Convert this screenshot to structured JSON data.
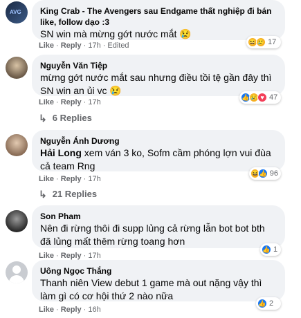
{
  "comments": [
    {
      "author": "King Crab - The Avengers sau Endgame thất nghiệp đi bán like, follow dạo :3",
      "text": "SN win mà mừng gớt nước mắt 😢",
      "like": "Like",
      "reply": "Reply",
      "time": "17h",
      "edited": "Edited",
      "reaction_count": "17"
    },
    {
      "author": "Nguyễn Văn Tiệp",
      "text": "mừng gớt nước mắt sau nhưng điều tồi tệ gần đây thì SN win an ủi vc 😢",
      "like": "Like",
      "reply": "Reply",
      "time": "17h",
      "reaction_count": "47",
      "replies": "6 Replies"
    },
    {
      "author": "Nguyễn Ánh Dương",
      "mention": "Hải Long",
      "text": " xem ván 3 ko, Sofm cầm phóng lợn vui đùa cả team Rng",
      "like": "Like",
      "reply": "Reply",
      "time": "17h",
      "reaction_count": "96",
      "replies": "21 Replies"
    },
    {
      "author": "Son Pham",
      "text": "Nên đi rừng thôi đi supp lủng cả rừng lẫn bot bot bth đã lủng mất thêm rừng toang hơn",
      "like": "Like",
      "reply": "Reply",
      "time": "17h",
      "reaction_count": "1"
    },
    {
      "author": "Uông Ngọc Thắng",
      "text": "Thanh niên View debut 1 game mà out nặng vậy thì làm gì có cơ hội thứ 2 nào nữa",
      "like": "Like",
      "reply": "Reply",
      "time": "16h",
      "reaction_count": "2"
    }
  ],
  "colors": {
    "like_blue": "#1877f2",
    "haha_yellow": "#f7b125",
    "love_red": "#f33e58",
    "bubble": "#f0f2f5"
  }
}
